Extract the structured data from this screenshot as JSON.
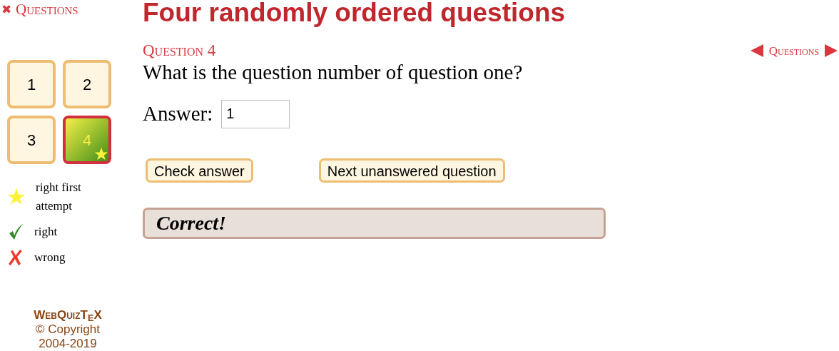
{
  "sidebar": {
    "close_link": {
      "icon": "✖",
      "label": "Questions"
    },
    "question_buttons": [
      {
        "label": "1",
        "selected": false,
        "kind": "unanswered"
      },
      {
        "label": "2",
        "selected": false,
        "kind": "unanswered"
      },
      {
        "label": "3",
        "selected": false,
        "kind": "unanswered"
      },
      {
        "label": "4",
        "selected": true,
        "kind": "rightfirst"
      }
    ],
    "legend": [
      {
        "kind": "star",
        "label": "right first attempt"
      },
      {
        "kind": "check",
        "label": "right"
      },
      {
        "kind": "cross",
        "label": "wrong"
      }
    ],
    "footer": {
      "brand": "WebQuizT$_{E}$X",
      "copyright": "© Copyright",
      "years": "2004-2019"
    }
  },
  "title": "Four randomly ordered questions",
  "question": {
    "heading": "Question 4",
    "nav_label": "Questions",
    "text": "What is the question number of question one?",
    "answer_label": "Answer:",
    "answer_value": "1"
  },
  "buttons": [
    "Check answer",
    "Next unanswered question"
  ],
  "feedback": "Correct!"
}
